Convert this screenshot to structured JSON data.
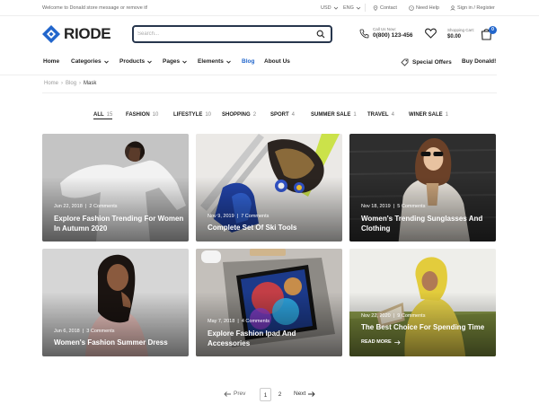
{
  "topbar": {
    "welcome": "Welcome to Donald store message or remove it!",
    "currency": "USD",
    "language": "ENG",
    "contact": "Contact",
    "help": "Need Help",
    "account": "Sign in / Register"
  },
  "header": {
    "logo": "RIODE",
    "search_placeholder": "Search...",
    "call_label": "Call Us Now:",
    "call_number": "0(800) 123-456",
    "cart_label": "Shopping Cart:",
    "cart_total": "$0.00",
    "cart_count": "0"
  },
  "nav": {
    "items": [
      {
        "label": "Home",
        "dropdown": false
      },
      {
        "label": "Categories",
        "dropdown": true
      },
      {
        "label": "Products",
        "dropdown": true
      },
      {
        "label": "Pages",
        "dropdown": true
      },
      {
        "label": "Elements",
        "dropdown": true
      },
      {
        "label": "Blog",
        "dropdown": false,
        "active": true
      },
      {
        "label": "About Us",
        "dropdown": false
      }
    ],
    "special_offers": "Special Offers",
    "buy": "Buy Donald!"
  },
  "breadcrumb": {
    "home": "Home",
    "blog": "Blog",
    "current": "Mask"
  },
  "filters": [
    {
      "label": "ALL",
      "count": "15",
      "active": true
    },
    {
      "label": "FASHION",
      "count": "10"
    },
    {
      "label": "LIFESTYLE",
      "count": "10"
    },
    {
      "label": "SHOPPING",
      "count": "2"
    },
    {
      "label": "SPORT",
      "count": "4"
    },
    {
      "label": "SUMMER SALE",
      "count": "1"
    },
    {
      "label": "TRAVEL",
      "count": "4"
    },
    {
      "label": "WINER SALE",
      "count": "1"
    }
  ],
  "posts": [
    {
      "date": "Jun 22, 2018",
      "comments": "2 Comments",
      "title": "Explore Fashion Trending For Women In Autumn 2020"
    },
    {
      "date": "Nov 9, 2019",
      "comments": "7 Comments",
      "title": "Complete Set Of Ski Tools"
    },
    {
      "date": "Nov 18, 2019",
      "comments": "5 Comments",
      "title": "Women's Trending Sunglasses And Clothing"
    },
    {
      "date": "Jun 6, 2018",
      "comments": "3 Comments",
      "title": "Women's Fashion Summer Dress"
    },
    {
      "date": "May 7, 2018",
      "comments": "4 Comments",
      "title": "Explore Fashion Ipad And Accessories"
    },
    {
      "date": "Nov 22, 2020",
      "comments": "9 Comments",
      "title": "The Best Choice For Spending Time",
      "read_more": "READ MORE"
    }
  ],
  "pagination": {
    "prev": "Prev",
    "pages": [
      "1",
      "2"
    ],
    "current": "1",
    "next": "Next"
  },
  "colors": {
    "accent": "#2266cc",
    "dark": "#27364d"
  }
}
